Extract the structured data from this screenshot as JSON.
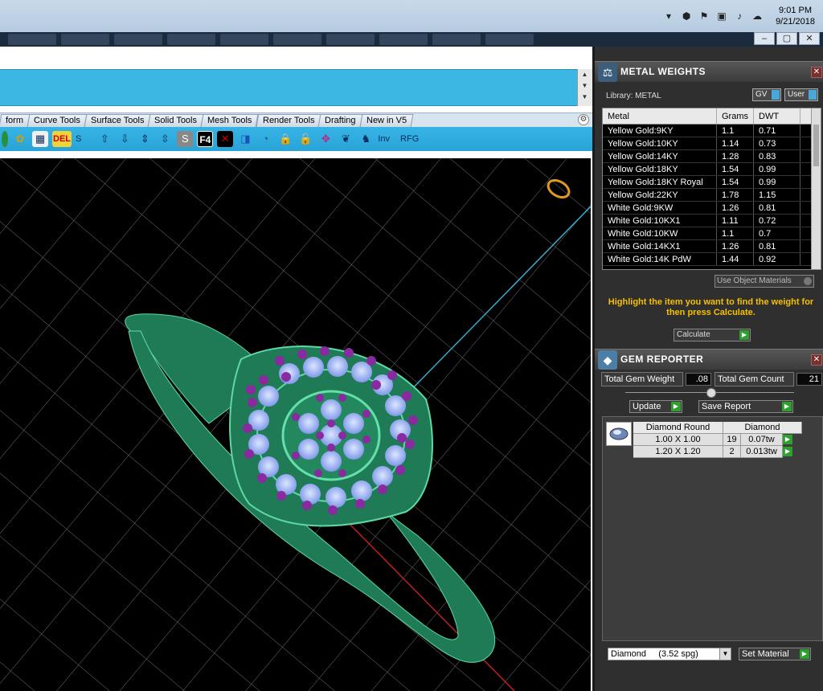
{
  "taskbar": {
    "time": "9:01 PM",
    "date": "9/21/2018",
    "tray_icons": [
      "chevron-up-icon",
      "shield-icon",
      "flag-icon",
      "network-icon",
      "volume-icon",
      "cloud-icon"
    ]
  },
  "window_controls": {
    "minimize": "–",
    "restore": "▢",
    "close": "✕"
  },
  "tabs": [
    "form",
    "Curve Tools",
    "Surface Tools",
    "Solid Tools",
    "Mesh Tools",
    "Render Tools",
    "Drafting",
    "New in V5"
  ],
  "toolbar": {
    "del_label": "DEL",
    "s_label": "S",
    "f4_label": "F4",
    "inv_label": "Inv",
    "rfg_label": "RFG"
  },
  "metal_weights": {
    "title": "METAL WEIGHTS",
    "library_label": "Library: METAL",
    "gv_label": "GV",
    "user_label": "User",
    "columns": [
      "Metal",
      "Grams",
      "DWT"
    ],
    "rows": [
      [
        "Yellow Gold:9KY",
        "1.1",
        "0.71"
      ],
      [
        "Yellow Gold:10KY",
        "1.14",
        "0.73"
      ],
      [
        "Yellow Gold:14KY",
        "1.28",
        "0.83"
      ],
      [
        "Yellow Gold:18KY",
        "1.54",
        "0.99"
      ],
      [
        "Yellow Gold:18KY Royal",
        "1.54",
        "0.99"
      ],
      [
        "Yellow Gold:22KY",
        "1.78",
        "1.15"
      ],
      [
        "White Gold:9KW",
        "1.26",
        "0.81"
      ],
      [
        "White Gold:10KX1",
        "1.11",
        "0.72"
      ],
      [
        "White Gold:10KW",
        "1.1",
        "0.7"
      ],
      [
        "White Gold:14KX1",
        "1.26",
        "0.81"
      ],
      [
        "White Gold:14K PdW",
        "1.44",
        "0.92"
      ]
    ],
    "use_object_materials": "Use Object Materials",
    "hint": "Highlight the item you want to find the weight for then press Calculate.",
    "calculate_label": "Calculate"
  },
  "gem_reporter": {
    "title": "GEM REPORTER",
    "total_weight_label": "Total Gem Weight",
    "total_weight_value": ".08",
    "total_count_label": "Total Gem Count",
    "total_count_value": "21",
    "update_label": "Update",
    "save_report_label": "Save Report",
    "columns": [
      "Diamond Round",
      "Diamond"
    ],
    "rows": [
      [
        "1.00 X 1.00",
        "19",
        "0.07tw"
      ],
      [
        "1.20 X 1.20",
        "2",
        "0.013tw"
      ]
    ],
    "material_select": "Diamond     (3.52 spg)",
    "set_material_label": "Set Material"
  }
}
